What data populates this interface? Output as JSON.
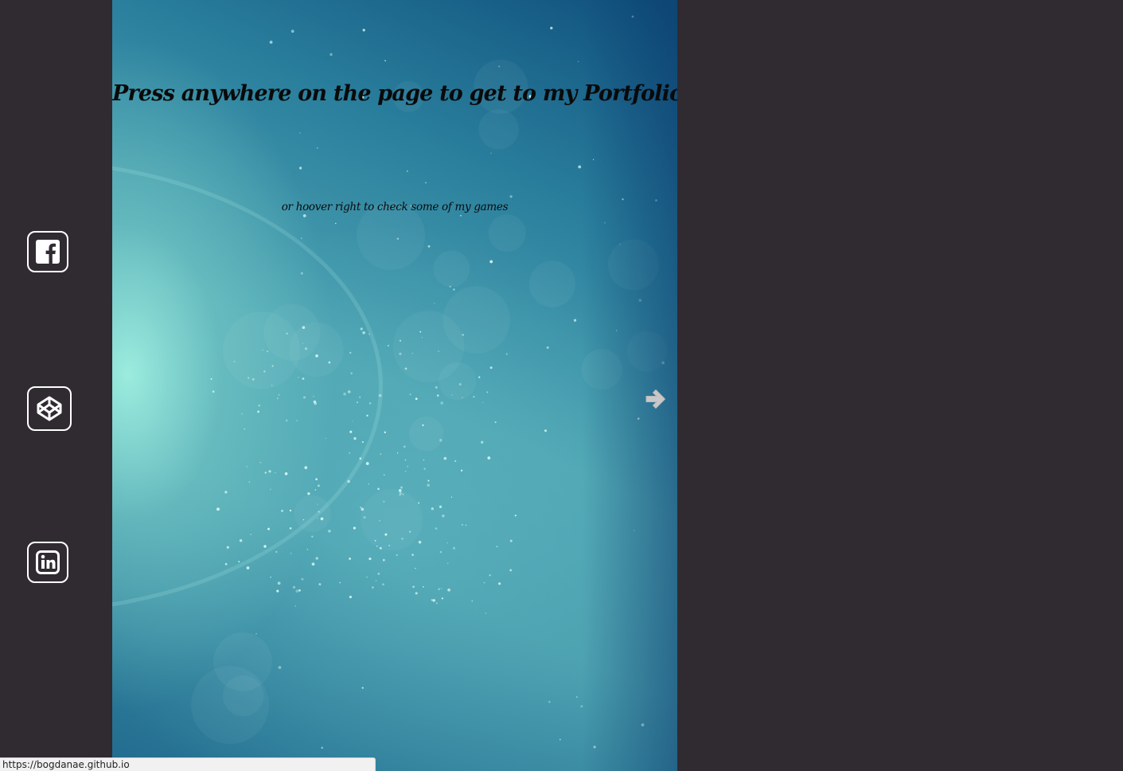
{
  "colors": {
    "page_background": "#302b31",
    "icon_stroke": "#ffffff",
    "text": "#0a0a0a",
    "arrow": "#c8c8c8"
  },
  "sidebar": {
    "items": [
      {
        "name": "facebook",
        "icon": "facebook-icon"
      },
      {
        "name": "codepen",
        "icon": "codepen-icon"
      },
      {
        "name": "linkedin",
        "icon": "linkedin-icon"
      }
    ]
  },
  "main": {
    "title": "Press anywhere on the page to get to my Portfolio site",
    "subtitle": "or hoover right to check some of my games",
    "next_icon": "arrow-right-icon"
  },
  "statusbar": {
    "url": "https://bogdanae.github.io"
  }
}
